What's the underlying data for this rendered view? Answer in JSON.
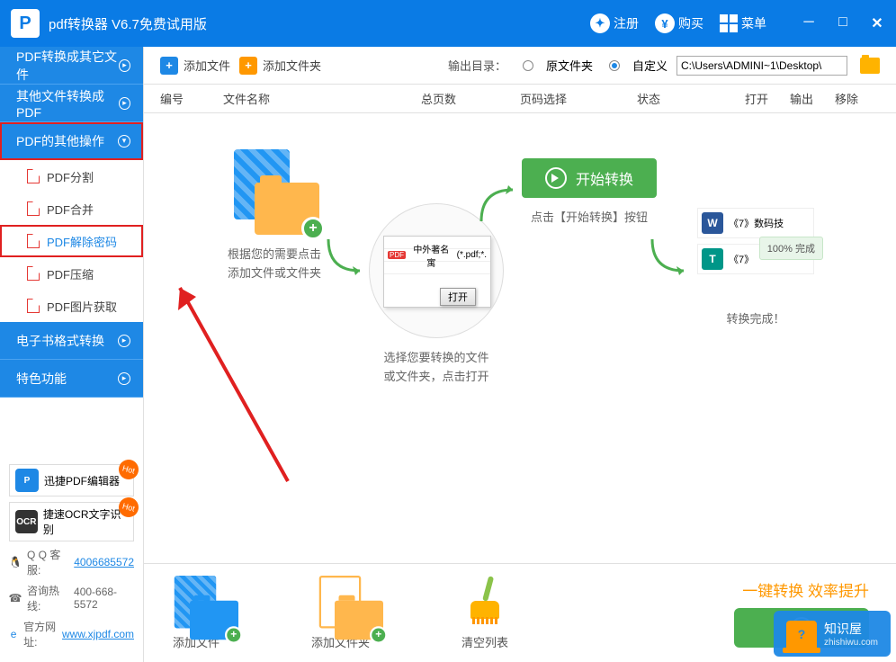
{
  "titlebar": {
    "app_title": "pdf转换器 V6.7免费试用版",
    "register": "注册",
    "buy": "购买",
    "menu": "菜单"
  },
  "sidebar": {
    "cats": {
      "pdf_to_other": "PDF转换成其它文件",
      "other_to_pdf": "其他文件转换成PDF",
      "pdf_ops": "PDF的其他操作",
      "ebook": "电子书格式转换",
      "special": "特色功能"
    },
    "items": {
      "split": "PDF分割",
      "merge": "PDF合并",
      "unlock": "PDF解除密码",
      "compress": "PDF压缩",
      "extract_img": "PDF图片获取"
    },
    "promos": {
      "editor": "迅捷PDF编辑器",
      "ocr": "捷速OCR文字识别",
      "hot": "Hot"
    },
    "contact": {
      "qq_label": "Q Q 客服:",
      "qq_value": "4006685572",
      "tel_label": "咨询热线:",
      "tel_value": "400-668-5572",
      "web_label": "官方网址:",
      "web_value": "www.xjpdf.com"
    }
  },
  "toolbar": {
    "add_file": "添加文件",
    "add_folder": "添加文件夹",
    "output_label": "输出目录：",
    "radio_original": "原文件夹",
    "radio_custom": "自定义",
    "path_value": "C:\\Users\\ADMINI~1\\Desktop\\"
  },
  "table": {
    "num": "编号",
    "name": "文件名称",
    "pages": "总页数",
    "pagesel": "页码选择",
    "status": "状态",
    "open": "打开",
    "out": "输出",
    "del": "移除"
  },
  "steps": {
    "s1_l1": "根据您的需要点击",
    "s1_l2": "添加文件或文件夹",
    "s2_l1": "选择您要转换的文件",
    "s2_l2": "或文件夹，点击打开",
    "s2_dialog_file": "中外著名寓",
    "s2_dialog_ext": "(*.pdf;*.",
    "s2_open": "打开",
    "s3_btn": "开始转换",
    "s3_cap": "点击【开始转换】按钮",
    "s4_item1": "《7》数码技",
    "s4_item2": "《7》",
    "s4_done": "100%  完成",
    "s4_cap": "转换完成！"
  },
  "bottom": {
    "add_file": "添加文件",
    "add_folder": "添加文件夹",
    "clear": "清空列表",
    "slogan": "一键转换  效率提升"
  },
  "watermark": {
    "title": "知识屋",
    "url": "zhishiwu.com"
  }
}
